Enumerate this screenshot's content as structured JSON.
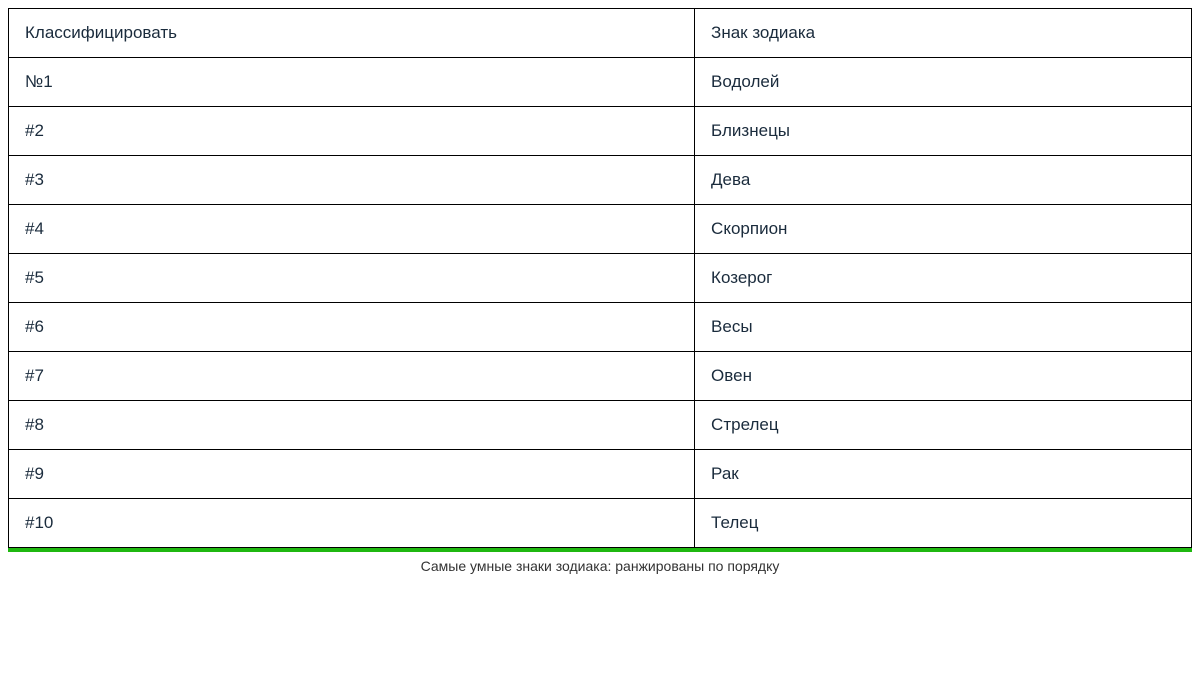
{
  "chart_data": {
    "type": "table",
    "columns": [
      "Классифицировать",
      "Знак зодиака"
    ],
    "rows": [
      [
        "№1",
        "Водолей"
      ],
      [
        "#2",
        "Близнецы"
      ],
      [
        "#3",
        "Дева"
      ],
      [
        "#4",
        "Скорпион"
      ],
      [
        "#5",
        "Козерог"
      ],
      [
        "#6",
        "Весы"
      ],
      [
        "#7",
        "Овен"
      ],
      [
        "#8",
        "Стрелец"
      ],
      [
        "#9",
        "Рак"
      ],
      [
        "#10",
        "Телец"
      ]
    ],
    "caption": "Самые умные знаки зодиака: ранжированы по порядку"
  }
}
